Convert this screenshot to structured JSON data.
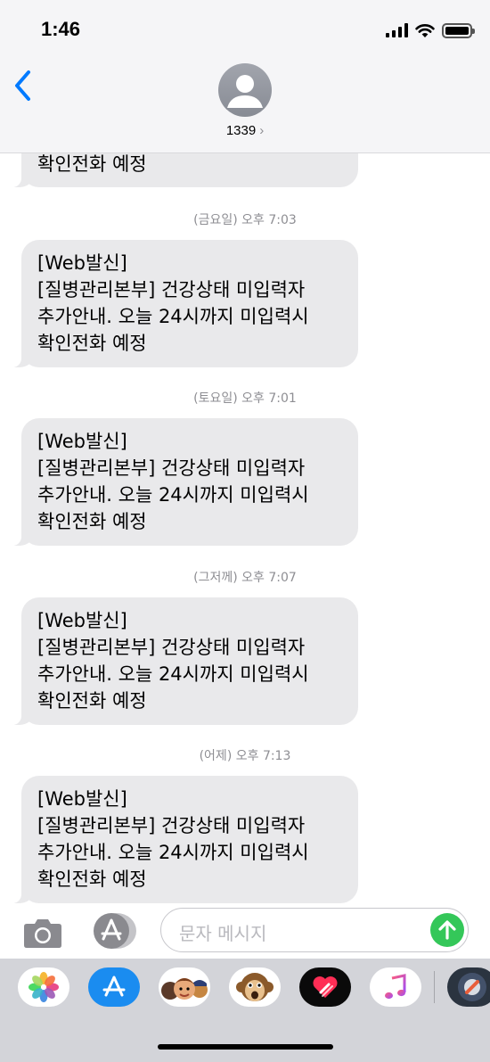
{
  "status_bar": {
    "time": "1:46"
  },
  "header": {
    "contact_name": "1339",
    "chevron": "›"
  },
  "messages": [
    {
      "lines": [
        "확인전화 예정"
      ]
    },
    {
      "timestamp": "(금요일) 오후 7:03",
      "lines": [
        "[Web발신]",
        "[질병관리본부] 건강상태 미입력자",
        "추가안내. 오늘 24시까지 미입력시",
        "확인전화 예정"
      ]
    },
    {
      "timestamp": "(토요일) 오후 7:01",
      "lines": [
        "[Web발신]",
        "[질병관리본부] 건강상태 미입력자",
        "추가안내. 오늘 24시까지 미입력시",
        "확인전화 예정"
      ]
    },
    {
      "timestamp": "(그저께) 오후 7:07",
      "lines": [
        "[Web발신]",
        "[질병관리본부] 건강상태 미입력자",
        "추가안내. 오늘 24시까지 미입력시",
        "확인전화 예정"
      ]
    },
    {
      "timestamp": "(어제) 오후 7:13",
      "lines": [
        "[Web발신]",
        "[질병관리본부] 건강상태 미입력자",
        "추가안내. 오늘 24시까지 미입력시",
        "확인전화 예정"
      ]
    }
  ],
  "input": {
    "placeholder": "문자 메시지"
  },
  "icons": {
    "back": "chevron-left-icon",
    "avatar": "person-icon",
    "camera": "camera-icon",
    "apps": "app-store-icon",
    "send": "arrow-up-icon",
    "strip": [
      "photos-icon",
      "app-store-icon",
      "memoji-icon",
      "animoji-monkey-icon",
      "digital-touch-icon",
      "music-icon",
      "app-icon"
    ]
  },
  "colors": {
    "accent": "#007aff",
    "bubble": "#e9e9eb",
    "send": "#34c759",
    "timestamp": "#8e8e93",
    "strip_bg": "#d3d4d9"
  }
}
